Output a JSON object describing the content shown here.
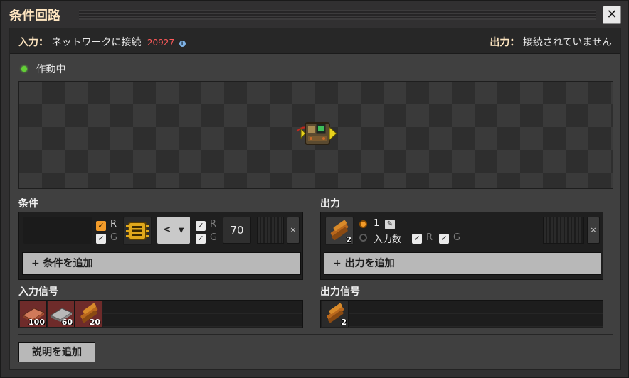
{
  "window": {
    "title": "条件回路",
    "close_glyph": "✕"
  },
  "status": {
    "input_label": "入力：",
    "input_value": "ネットワークに接続",
    "network_id": "20927",
    "info_glyph": "i",
    "output_label": "出力：",
    "output_value": "接続されていません"
  },
  "state": {
    "text": "作動中",
    "color": "#62d035"
  },
  "conditions": {
    "title": "条件",
    "left_wires": {
      "red": "R",
      "green": "G",
      "red_checked": true,
      "green_checked": true
    },
    "comparator": "<",
    "right_wires": {
      "red": "R",
      "green": "G",
      "red_checked": true,
      "green_checked": true
    },
    "constant": "70",
    "remove_glyph": "×",
    "add_label": "+ 条件を追加"
  },
  "outputs": {
    "title": "出力",
    "signal_count": "2",
    "radio_one_label": "1",
    "radio_input_label": "入力数",
    "wires": {
      "red": "R",
      "green": "G",
      "red_checked": true,
      "green_checked": true
    },
    "remove_glyph": "×",
    "add_label": "+ 出力を追加"
  },
  "input_signals": {
    "title": "入力信号",
    "items": [
      {
        "icon": "copper-plate-icon",
        "count": "100"
      },
      {
        "icon": "iron-plate-icon",
        "count": "60"
      },
      {
        "icon": "wood-icon",
        "count": "20"
      }
    ]
  },
  "output_signals": {
    "title": "出力信号",
    "items": [
      {
        "icon": "wood-icon",
        "count": "2"
      }
    ]
  },
  "description_button": "説明を追加",
  "colors": {
    "accent_orange": "#f39c2a",
    "network_red": "#ff5a5a",
    "title": "#ffe6c0"
  }
}
